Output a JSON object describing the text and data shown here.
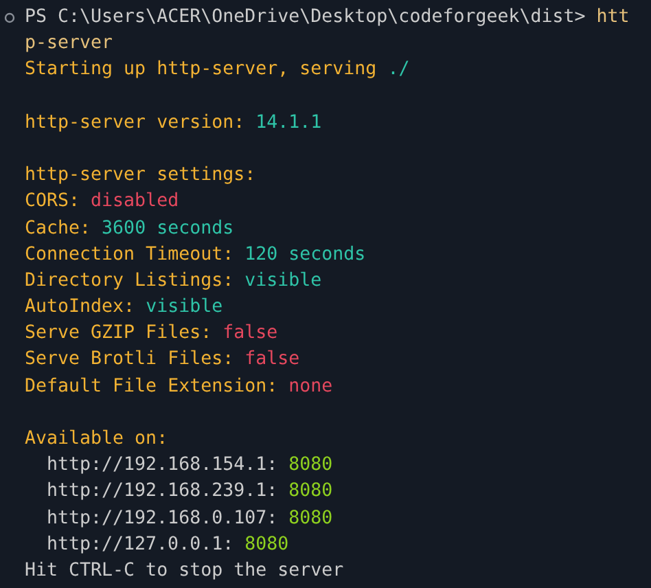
{
  "terminal": {
    "lines": [
      {
        "kind": "text",
        "segments": [
          {
            "text": "PS C:\\Users\\ACER\\OneDrive\\Desktop\\codeforgeek\\dist>",
            "color": "#cccccc"
          },
          {
            "text": "htt",
            "color": "#e5c07b"
          }
        ]
      },
      {
        "kind": "text",
        "segments": [
          {
            "text": "p-server",
            "color": "#e5c07b"
          }
        ]
      },
      {
        "kind": "text",
        "segments": [
          {
            "text": "Starting up http-server, serving",
            "color": "#f2b233"
          },
          {
            "text": "./",
            "color": "#2fc4a8"
          }
        ]
      },
      {
        "kind": "blank"
      },
      {
        "kind": "text",
        "segments": [
          {
            "text": "http-server version:",
            "color": "#f2b233"
          },
          {
            "text": "14.1.1",
            "color": "#2fc4a8"
          }
        ]
      },
      {
        "kind": "blank"
      },
      {
        "kind": "text",
        "segments": [
          {
            "text": "http-server settings:",
            "color": "#f2b233"
          }
        ]
      },
      {
        "kind": "text",
        "segments": [
          {
            "text": "CORS:",
            "color": "#f2b233"
          },
          {
            "text": "disabled",
            "color": "#e5485e"
          }
        ]
      },
      {
        "kind": "text",
        "segments": [
          {
            "text": "Cache:",
            "color": "#f2b233"
          },
          {
            "text": "3600 seconds",
            "color": "#2fc4a8"
          }
        ]
      },
      {
        "kind": "text",
        "segments": [
          {
            "text": "Connection Timeout:",
            "color": "#f2b233"
          },
          {
            "text": "120 seconds",
            "color": "#2fc4a8"
          }
        ]
      },
      {
        "kind": "text",
        "segments": [
          {
            "text": "Directory Listings:",
            "color": "#f2b233"
          },
          {
            "text": "visible",
            "color": "#2fc4a8"
          }
        ]
      },
      {
        "kind": "text",
        "segments": [
          {
            "text": "AutoIndex:",
            "color": "#f2b233"
          },
          {
            "text": "visible",
            "color": "#2fc4a8"
          }
        ]
      },
      {
        "kind": "text",
        "segments": [
          {
            "text": "Serve GZIP Files:",
            "color": "#f2b233"
          },
          {
            "text": "false",
            "color": "#e5485e"
          }
        ]
      },
      {
        "kind": "text",
        "segments": [
          {
            "text": "Serve Brotli Files:",
            "color": "#f2b233"
          },
          {
            "text": "false",
            "color": "#e5485e"
          }
        ]
      },
      {
        "kind": "text",
        "segments": [
          {
            "text": "Default File Extension:",
            "color": "#f2b233"
          },
          {
            "text": "none",
            "color": "#e5485e"
          }
        ]
      },
      {
        "kind": "blank"
      },
      {
        "kind": "text",
        "segments": [
          {
            "text": "Available on:",
            "color": "#f2b233"
          }
        ],
        "children": [
          {
            "kind": "text",
            "segments": [
              {
                "text": "http://192.168.154.1:",
                "color": "#cccccc"
              },
              {
                "text": "8080",
                "color": "#8fd11f"
              }
            ]
          },
          {
            "kind": "text",
            "segments": [
              {
                "text": "http://192.168.239.1:",
                "color": "#cccccc"
              },
              {
                "text": "8080",
                "color": "#8fd11f"
              }
            ]
          },
          {
            "kind": "text",
            "segments": [
              {
                "text": "http://192.168.0.107:",
                "color": "#cccccc"
              },
              {
                "text": "8080",
                "color": "#8fd11f"
              }
            ]
          },
          {
            "kind": "text",
            "segments": [
              {
                "text": "http://127.0.0.1:",
                "color": "#cccccc"
              },
              {
                "text": "8080",
                "color": "#8fd11f"
              }
            ]
          }
        ]
      },
      {
        "kind": "text",
        "segments": [
          {
            "text": "Hit CTRL-C to stop the server",
            "color": "#cccccc"
          }
        ]
      }
    ]
  }
}
